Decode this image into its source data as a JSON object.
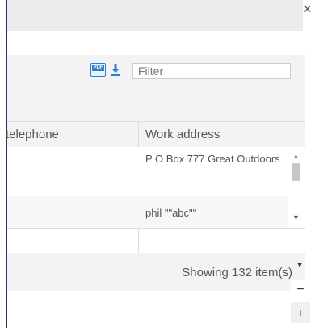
{
  "window": {
    "close_glyph": "×"
  },
  "toolbar": {
    "pdf_icon_label": "PDF",
    "download_icon": "download-icon",
    "filter_placeholder": "Filter"
  },
  "table": {
    "columns": [
      {
        "label": "telephone"
      },
      {
        "label": "Work address"
      }
    ],
    "rows": [
      {
        "telephone": "",
        "work_address": "P O Box 777 Great Outdoors"
      },
      {
        "telephone": "",
        "work_address": "phil \"\"abc\"\""
      }
    ]
  },
  "status": {
    "text": "Showing 132 item(s)",
    "caret": "▼"
  },
  "zoom": {
    "minus": "−",
    "plus": "+"
  },
  "colors": {
    "accent": "#2b7fd3",
    "header_bg": "#f3f3f3",
    "border": "#dddddd"
  }
}
